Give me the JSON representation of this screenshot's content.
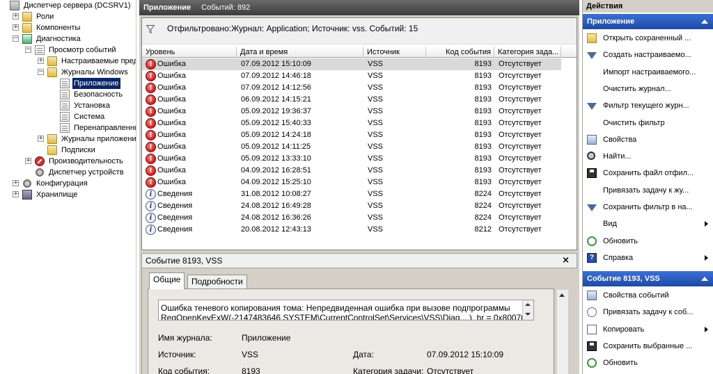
{
  "tree": [
    {
      "label": "Диспетчер сервера (DCSRV1)",
      "icon": "server-icon",
      "depth": 0,
      "expander": ""
    },
    {
      "label": "Роли",
      "icon": "roles-icon",
      "depth": 1,
      "expander": "+"
    },
    {
      "label": "Компоненты",
      "icon": "features-icon",
      "depth": 1,
      "expander": "+"
    },
    {
      "label": "Диагностика",
      "icon": "diagnostics-icon",
      "depth": 1,
      "expander": "−"
    },
    {
      "label": "Просмотр событий",
      "icon": "event-viewer-icon",
      "depth": 2,
      "expander": "−"
    },
    {
      "label": "Настраиваемые представления",
      "icon": "folder-icon",
      "depth": 3,
      "expander": "+"
    },
    {
      "label": "Журналы Windows",
      "icon": "folder-icon",
      "depth": 3,
      "expander": "−"
    },
    {
      "label": "Приложение",
      "icon": "log-icon",
      "depth": 4,
      "expander": "",
      "selected": true
    },
    {
      "label": "Безопасность",
      "icon": "log-icon",
      "depth": 4,
      "expander": ""
    },
    {
      "label": "Установка",
      "icon": "log-icon",
      "depth": 4,
      "expander": ""
    },
    {
      "label": "Система",
      "icon": "log-icon",
      "depth": 4,
      "expander": ""
    },
    {
      "label": "Перенаправленные события",
      "icon": "log-icon",
      "depth": 4,
      "expander": ""
    },
    {
      "label": "Журналы приложений и служб",
      "icon": "folder-icon",
      "depth": 3,
      "expander": "+"
    },
    {
      "label": "Подписки",
      "icon": "folder-icon",
      "depth": 3,
      "expander": ""
    },
    {
      "label": "Производительность",
      "icon": "performance-icon",
      "depth": 2,
      "expander": "+"
    },
    {
      "label": "Диспетчер устройств",
      "icon": "device-manager-icon",
      "depth": 2,
      "expander": ""
    },
    {
      "label": "Конфигурация",
      "icon": "configuration-icon",
      "depth": 1,
      "expander": "+"
    },
    {
      "label": "Хранилище",
      "icon": "storage-icon",
      "depth": 1,
      "expander": "+"
    }
  ],
  "header": {
    "title": "Приложение",
    "count": "Событий: 892"
  },
  "filter_text": "Отфильтровано:Журнал: Application; Источник: vss. Событий: 15",
  "columns": [
    "Уровень",
    "Дата и время",
    "Источник",
    "Код события",
    "Категория зада..."
  ],
  "events": [
    {
      "level": "Ошибка",
      "type": "error",
      "datetime": "07.09.2012 15:10:09",
      "source": "VSS",
      "id": "8193",
      "category": "Отсутствует"
    },
    {
      "level": "Ошибка",
      "type": "error",
      "datetime": "07.09.2012 14:46:18",
      "source": "VSS",
      "id": "8193",
      "category": "Отсутствует"
    },
    {
      "level": "Ошибка",
      "type": "error",
      "datetime": "07.09.2012 14:12:56",
      "source": "VSS",
      "id": "8193",
      "category": "Отсутствует"
    },
    {
      "level": "Ошибка",
      "type": "error",
      "datetime": "06.09.2012 14:15:21",
      "source": "VSS",
      "id": "8193",
      "category": "Отсутствует"
    },
    {
      "level": "Ошибка",
      "type": "error",
      "datetime": "05.09.2012 19:36:37",
      "source": "VSS",
      "id": "8193",
      "category": "Отсутствует"
    },
    {
      "level": "Ошибка",
      "type": "error",
      "datetime": "05.09.2012 15:40:33",
      "source": "VSS",
      "id": "8193",
      "category": "Отсутствует"
    },
    {
      "level": "Ошибка",
      "type": "error",
      "datetime": "05.09.2012 14:24:18",
      "source": "VSS",
      "id": "8193",
      "category": "Отсутствует"
    },
    {
      "level": "Ошибка",
      "type": "error",
      "datetime": "05.09.2012 14:11:25",
      "source": "VSS",
      "id": "8193",
      "category": "Отсутствует"
    },
    {
      "level": "Ошибка",
      "type": "error",
      "datetime": "05.09.2012 13:33:10",
      "source": "VSS",
      "id": "8193",
      "category": "Отсутствует"
    },
    {
      "level": "Ошибка",
      "type": "error",
      "datetime": "04.09.2012 16:28:51",
      "source": "VSS",
      "id": "8193",
      "category": "Отсутствует"
    },
    {
      "level": "Ошибка",
      "type": "error",
      "datetime": "04.09.2012 15:25:10",
      "source": "VSS",
      "id": "8193",
      "category": "Отсутствует"
    },
    {
      "level": "Сведения",
      "type": "info",
      "datetime": "31.08.2012 10:08:27",
      "source": "VSS",
      "id": "8224",
      "category": "Отсутствует"
    },
    {
      "level": "Сведения",
      "type": "info",
      "datetime": "24.08.2012 16:49:28",
      "source": "VSS",
      "id": "8224",
      "category": "Отсутствует"
    },
    {
      "level": "Сведения",
      "type": "info",
      "datetime": "24.08.2012 16:36:26",
      "source": "VSS",
      "id": "8224",
      "category": "Отсутствует"
    },
    {
      "level": "Сведения",
      "type": "info",
      "datetime": "20.08.2012 12:43:13",
      "source": "VSS",
      "id": "8212",
      "category": "Отсутствует"
    }
  ],
  "detail": {
    "title": "Событие 8193, VSS",
    "close": "×",
    "tabs": [
      "Общие",
      "Подробности"
    ],
    "description_line1": "Ошибка теневого копирования тома: Непредвиденная ошибка при вызове подпрограммы",
    "description_line2": "RegOpenKeyExW(-2147483646,SYSTEM\\CurrentControlSet\\Services\\VSS\\Diag,...). hr = 0x80070005",
    "fields": {
      "log_label": "Имя журнала:",
      "log_value": "Приложение",
      "source_label": "Источник:",
      "source_value": "VSS",
      "date_label": "Дата:",
      "date_value": "07.09.2012 15:10:09",
      "id_label": "Код события:",
      "id_value": "8193",
      "category_label": "Категория задачи:",
      "category_value": "Отсутствует"
    }
  },
  "actions": {
    "title": "Действия",
    "section1": "Приложение",
    "items1": [
      {
        "label": "Открыть сохраненный ...",
        "icon": "open-folder-icon",
        "sub": false
      },
      {
        "label": "Создать настраиваемо...",
        "icon": "filter-icon",
        "sub": false
      },
      {
        "label": "Импорт настраиваемого...",
        "icon": "",
        "sub": false
      },
      {
        "label": "Очистить журнал...",
        "icon": "",
        "sub": false
      },
      {
        "label": "Фильтр текущего журн...",
        "icon": "filter-icon",
        "sub": false
      },
      {
        "label": "Очистить фильтр",
        "icon": "",
        "sub": false
      },
      {
        "label": "Свойства",
        "icon": "properties-icon",
        "sub": false
      },
      {
        "label": "Найти...",
        "icon": "find-icon",
        "sub": false
      },
      {
        "label": "Сохранить файл отфил...",
        "icon": "save-icon",
        "sub": false
      },
      {
        "label": "Привязать задачу к жу...",
        "icon": "",
        "sub": false
      },
      {
        "label": "Сохранить фильтр в на...",
        "icon": "filter-icon",
        "sub": false
      },
      {
        "label": "Вид",
        "icon": "",
        "sub": true
      },
      {
        "label": "Обновить",
        "icon": "refresh-icon",
        "sub": false
      },
      {
        "label": "Справка",
        "icon": "help-icon",
        "sub": true
      }
    ],
    "section2": "Событие 8193, VSS",
    "items2": [
      {
        "label": "Свойства событий",
        "icon": "properties-icon",
        "sub": false
      },
      {
        "label": "Привязать задачу к соб...",
        "icon": "task-icon",
        "sub": false
      },
      {
        "label": "Копировать",
        "icon": "copy-icon",
        "sub": true
      },
      {
        "label": "Сохранить выбранные ...",
        "icon": "save-icon",
        "sub": false
      },
      {
        "label": "Обновить",
        "icon": "refresh-icon",
        "sub": false
      }
    ]
  }
}
